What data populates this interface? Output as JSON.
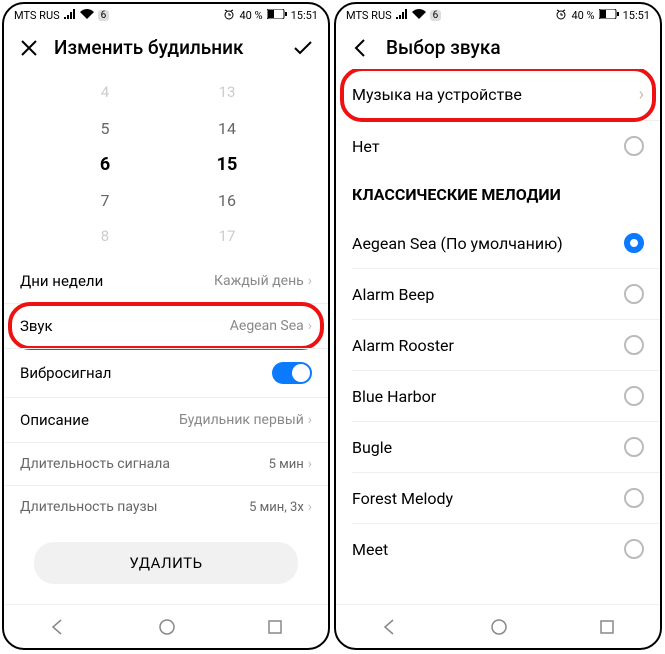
{
  "status": {
    "carrier": "MTS RUS",
    "signal_icon": "signal",
    "wifi_icon": "wifi",
    "notif_count": "6",
    "alarm_icon": "alarm",
    "battery_pct": "40 %",
    "time": "15:51"
  },
  "phone1": {
    "title": "Изменить будильник",
    "time_picker": {
      "hours": [
        "4",
        "5",
        "6",
        "7",
        "8"
      ],
      "minutes": [
        "13",
        "14",
        "15",
        "16",
        "17"
      ],
      "selected_idx": 2
    },
    "rows": {
      "days": {
        "label": "Дни недели",
        "value": "Каждый день"
      },
      "sound": {
        "label": "Звук",
        "value": "Aegean Sea"
      },
      "vibrate": {
        "label": "Вибросигнал"
      },
      "desc": {
        "label": "Описание",
        "value": "Будильник первый"
      },
      "dur": {
        "label": "Длительность сигнала",
        "value": "5 мин"
      },
      "pause": {
        "label": "Длительность паузы",
        "value": "5 мин, 3x"
      }
    },
    "delete": "УДАЛИТЬ"
  },
  "phone2": {
    "title": "Выбор звука",
    "music_on_device": "Музыка на устройстве",
    "none": "Нет",
    "section": "КЛАССИЧЕСКИЕ МЕЛОДИИ",
    "items": [
      {
        "name": "Aegean Sea (По умолчанию)",
        "selected": true
      },
      {
        "name": "Alarm Beep",
        "selected": false
      },
      {
        "name": "Alarm Rooster",
        "selected": false
      },
      {
        "name": "Blue Harbor",
        "selected": false
      },
      {
        "name": "Bugle",
        "selected": false
      },
      {
        "name": "Forest Melody",
        "selected": false
      },
      {
        "name": "Meet",
        "selected": false
      }
    ]
  }
}
